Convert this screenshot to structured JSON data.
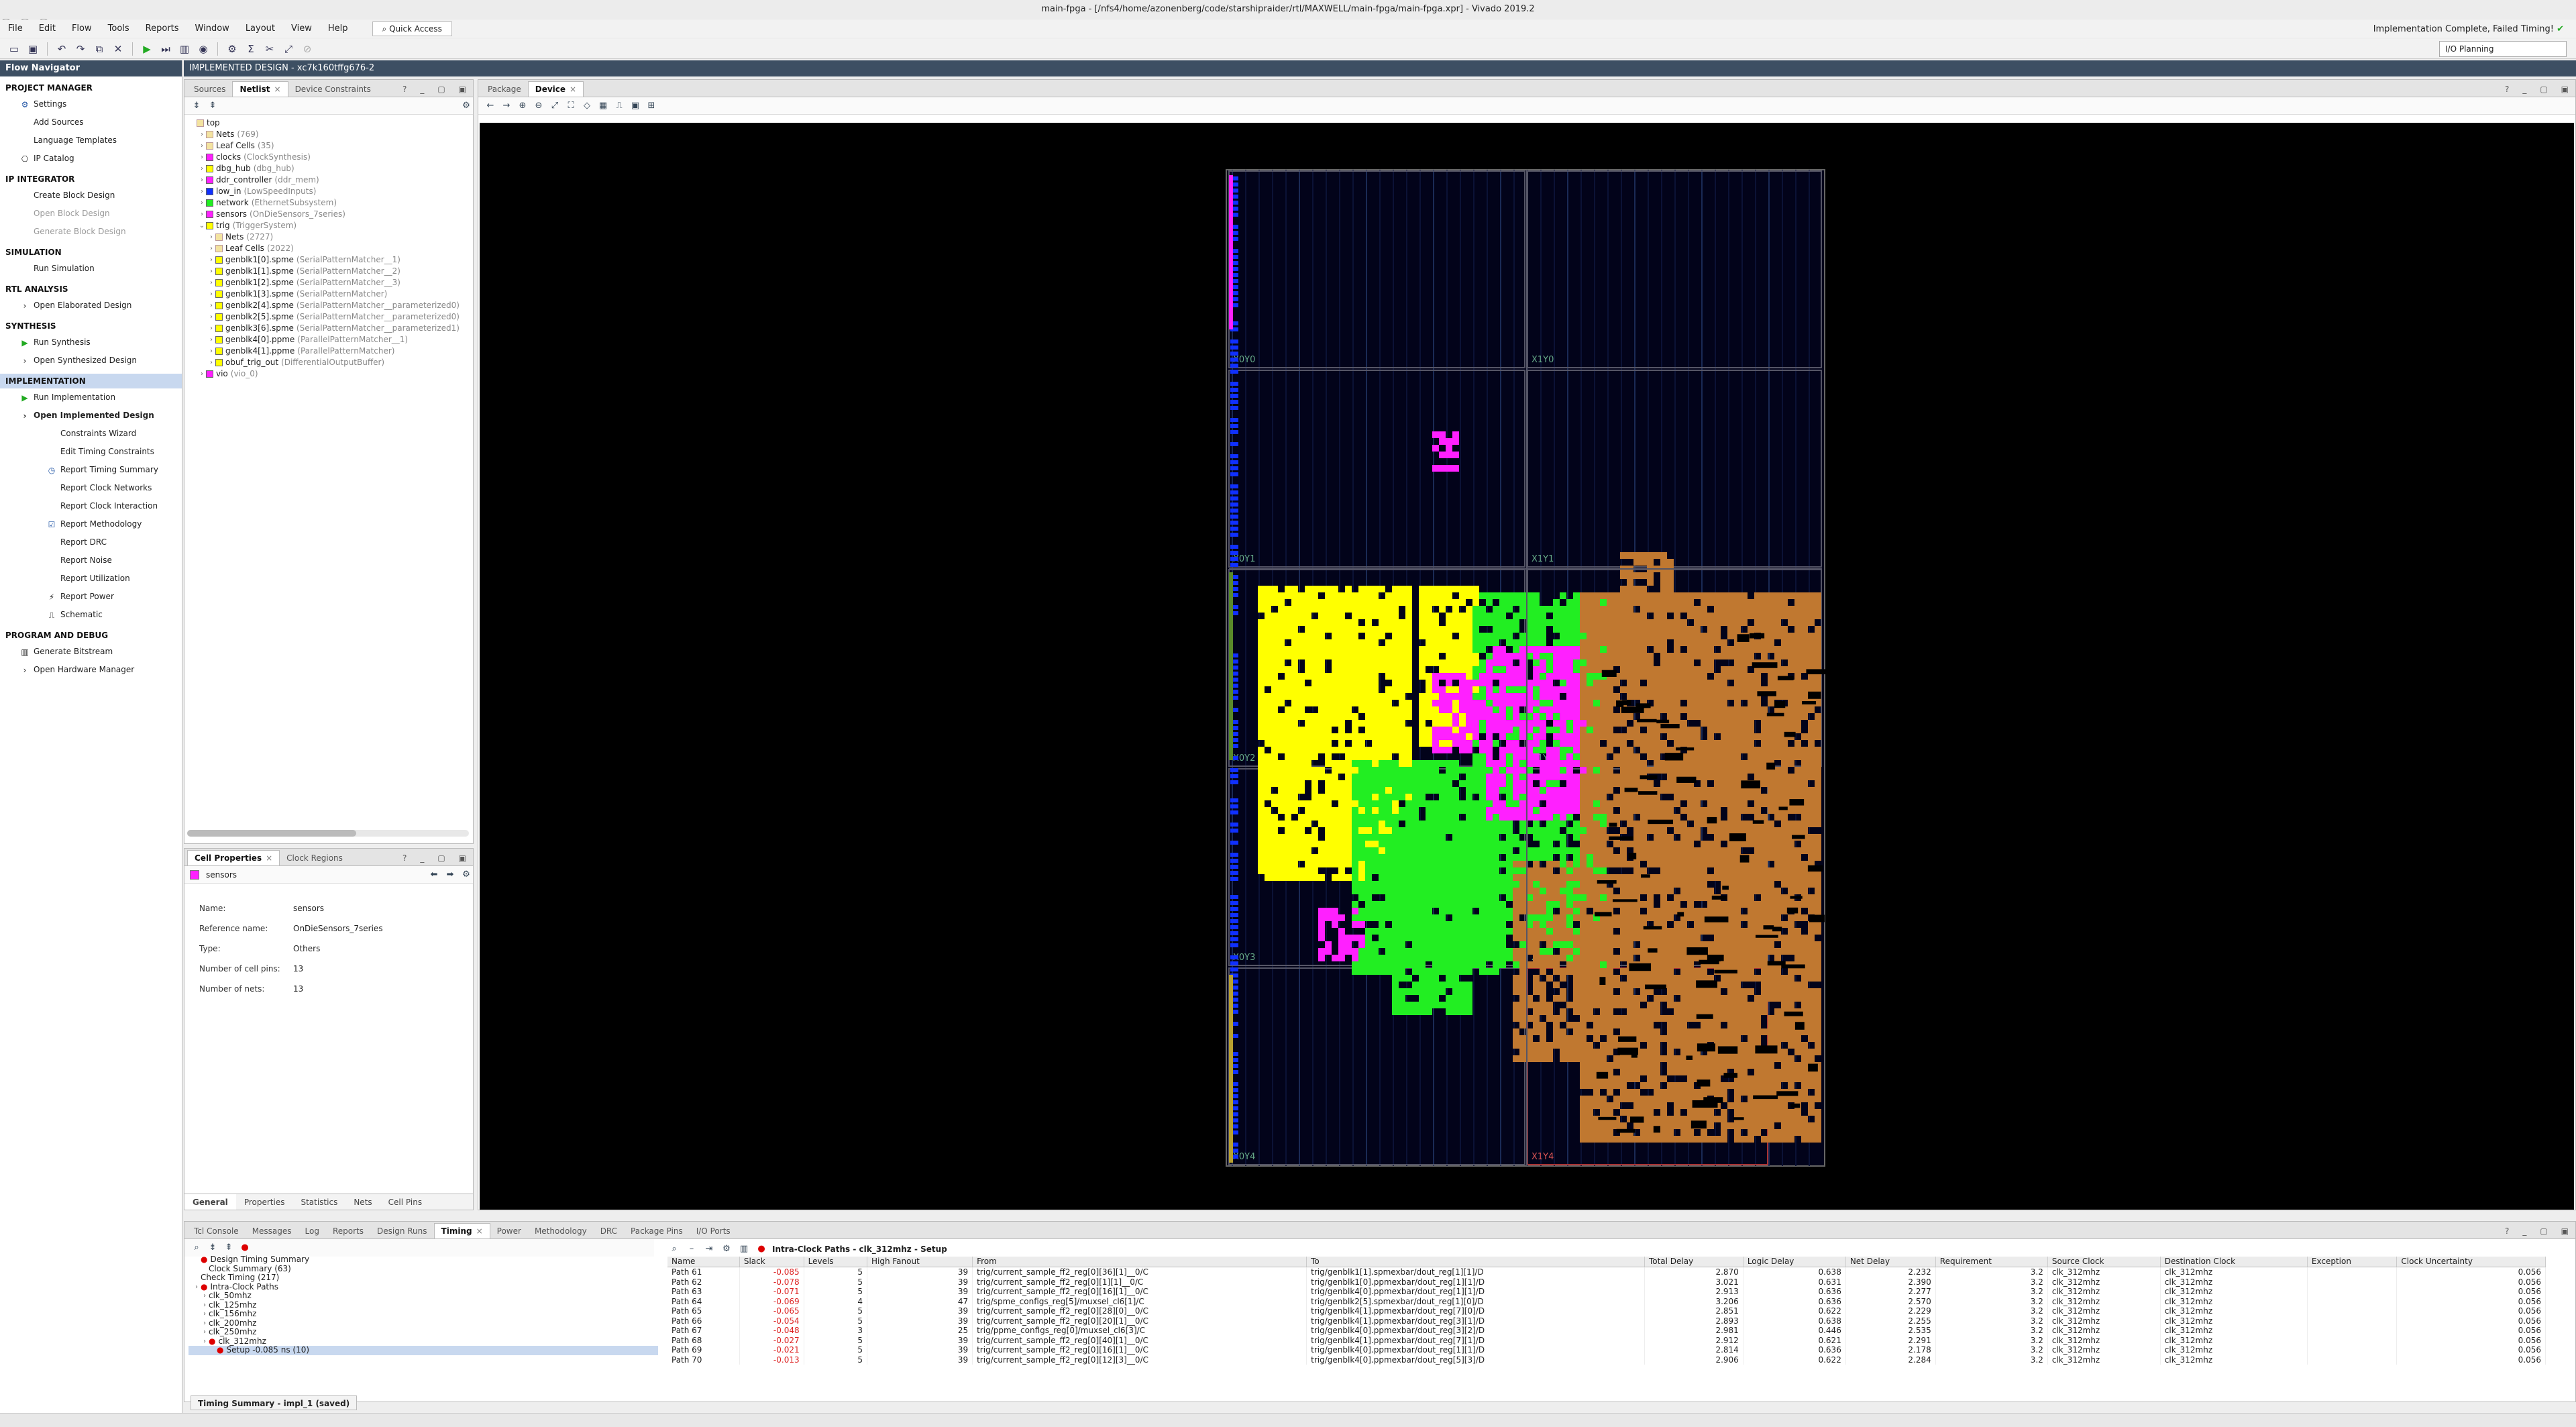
{
  "window": {
    "title": "main-fpga - [/nfs4/home/azonenberg/code/starshipraider/rtl/MAXWELL/main-fpga/main-fpga.xpr] - Vivado 2019.2",
    "status": "Implementation Complete, Failed Timing!"
  },
  "menu": [
    "File",
    "Edit",
    "Flow",
    "Tools",
    "Reports",
    "Window",
    "Layout",
    "View",
    "Help"
  ],
  "quick_access": "Quick Access",
  "layout_select": "I/O Planning",
  "flow_navigator": {
    "title": "Flow Navigator",
    "sections": [
      {
        "title": "PROJECT MANAGER",
        "items": [
          {
            "label": "Settings",
            "icon": "gear-icon"
          },
          {
            "label": "Add Sources"
          },
          {
            "label": "Language Templates"
          },
          {
            "label": "IP Catalog",
            "icon": "ip-icon"
          }
        ]
      },
      {
        "title": "IP INTEGRATOR",
        "items": [
          {
            "label": "Create Block Design"
          },
          {
            "label": "Open Block Design",
            "disabled": true
          },
          {
            "label": "Generate Block Design",
            "disabled": true
          }
        ]
      },
      {
        "title": "SIMULATION",
        "items": [
          {
            "label": "Run Simulation"
          }
        ]
      },
      {
        "title": "RTL ANALYSIS",
        "items": [
          {
            "label": "Open Elaborated Design",
            "expander": true
          }
        ]
      },
      {
        "title": "SYNTHESIS",
        "items": [
          {
            "label": "Run Synthesis",
            "icon": "run-icon"
          },
          {
            "label": "Open Synthesized Design",
            "expander": true
          }
        ]
      },
      {
        "title": "IMPLEMENTATION",
        "active": true,
        "items": [
          {
            "label": "Run Implementation",
            "icon": "run-icon"
          },
          {
            "label": "Open Implemented Design",
            "expander": true,
            "bold": true
          },
          {
            "label": "Constraints Wizard",
            "indent": 2
          },
          {
            "label": "Edit Timing Constraints",
            "indent": 2
          },
          {
            "label": "Report Timing Summary",
            "indent": 2,
            "icon": "clock-icon"
          },
          {
            "label": "Report Clock Networks",
            "indent": 2
          },
          {
            "label": "Report Clock Interaction",
            "indent": 2
          },
          {
            "label": "Report Methodology",
            "indent": 2,
            "icon": "check-icon"
          },
          {
            "label": "Report DRC",
            "indent": 2
          },
          {
            "label": "Report Noise",
            "indent": 2
          },
          {
            "label": "Report Utilization",
            "indent": 2
          },
          {
            "label": "Report Power",
            "indent": 2,
            "icon": "power-icon"
          },
          {
            "label": "Schematic",
            "indent": 2,
            "icon": "schematic-icon"
          }
        ]
      },
      {
        "title": "PROGRAM AND DEBUG",
        "items": [
          {
            "label": "Generate Bitstream",
            "icon": "bitstream-icon"
          },
          {
            "label": "Open Hardware Manager",
            "expander": true
          }
        ]
      }
    ]
  },
  "impl_header": "IMPLEMENTED DESIGN - xc7k160tffg676-2",
  "netlist": {
    "tabs": [
      "Sources",
      "Netlist",
      "Device Constraints"
    ],
    "selected": 1,
    "tree": [
      {
        "t": "top",
        "d": 0
      },
      {
        "t": "Nets",
        "s": "(769)",
        "d": 1
      },
      {
        "t": "Leaf Cells",
        "s": "(35)",
        "d": 1
      },
      {
        "t": "clocks",
        "s": "(ClockSynthesis)",
        "d": 1,
        "c": "#ff20ff"
      },
      {
        "t": "dbg_hub",
        "s": "(dbg_hub)",
        "d": 1,
        "c": "#ffff00"
      },
      {
        "t": "ddr_controller",
        "s": "(ddr_mem)",
        "d": 1,
        "c": "#ff20ff"
      },
      {
        "t": "low_in",
        "s": "(LowSpeedInputs)",
        "d": 1,
        "c": "#1030ff"
      },
      {
        "t": "network",
        "s": "(EthernetSubsystem)",
        "d": 1,
        "c": "#22ee22"
      },
      {
        "t": "sensors",
        "s": "(OnDieSensors_7series)",
        "d": 1,
        "c": "#ff20ff"
      },
      {
        "t": "trig",
        "s": "(TriggerSystem)",
        "d": 1,
        "c": "#ffff00",
        "open": true
      },
      {
        "t": "Nets",
        "s": "(2727)",
        "d": 2
      },
      {
        "t": "Leaf Cells",
        "s": "(2022)",
        "d": 2
      },
      {
        "t": "genblk1[0].spme",
        "s": "(SerialPatternMatcher__1)",
        "d": 2,
        "c": "#ffff00"
      },
      {
        "t": "genblk1[1].spme",
        "s": "(SerialPatternMatcher__2)",
        "d": 2,
        "c": "#ffff00"
      },
      {
        "t": "genblk1[2].spme",
        "s": "(SerialPatternMatcher__3)",
        "d": 2,
        "c": "#ffff00"
      },
      {
        "t": "genblk1[3].spme",
        "s": "(SerialPatternMatcher)",
        "d": 2,
        "c": "#ffff00"
      },
      {
        "t": "genblk2[4].spme",
        "s": "(SerialPatternMatcher__parameterized0)",
        "d": 2,
        "c": "#ffff00"
      },
      {
        "t": "genblk2[5].spme",
        "s": "(SerialPatternMatcher__parameterized0)",
        "d": 2,
        "c": "#ffff00"
      },
      {
        "t": "genblk3[6].spme",
        "s": "(SerialPatternMatcher__parameterized1)",
        "d": 2,
        "c": "#ffff00"
      },
      {
        "t": "genblk4[0].ppme",
        "s": "(ParallelPatternMatcher__1)",
        "d": 2,
        "c": "#ffff00"
      },
      {
        "t": "genblk4[1].ppme",
        "s": "(ParallelPatternMatcher)",
        "d": 2,
        "c": "#ffff00"
      },
      {
        "t": "obuf_trig_out",
        "s": "(DifferentialOutputBuffer)",
        "d": 2,
        "c": "#ffff00"
      },
      {
        "t": "vio",
        "s": "(vio_0)",
        "d": 1,
        "c": "#ff20ff"
      }
    ]
  },
  "cell_properties": {
    "tabs": [
      "Cell Properties",
      "Clock Regions"
    ],
    "cell": "sensors",
    "rows": [
      {
        "k": "Name:",
        "v": "sensors"
      },
      {
        "k": "Reference name:",
        "v": "OnDieSensors_7series"
      },
      {
        "k": "Type:",
        "v": "Others"
      },
      {
        "k": "Number of cell pins:",
        "v": "13"
      },
      {
        "k": "Number of nets:",
        "v": "13"
      }
    ],
    "bottom_tabs": [
      "General",
      "Properties",
      "Statistics",
      "Nets",
      "Cell Pins"
    ]
  },
  "device": {
    "tabs": [
      "Package",
      "Device"
    ],
    "selected": 1,
    "regions": [
      "X0Y4",
      "X1Y4",
      "X0Y3",
      "X1Y3",
      "X0Y2",
      "X1Y2",
      "X0Y1",
      "X1Y1",
      "X0Y0",
      "X1Y0"
    ]
  },
  "bottom": {
    "tabs": [
      "Tcl Console",
      "Messages",
      "Log",
      "Reports",
      "Design Runs",
      "Timing",
      "Power",
      "Methodology",
      "DRC",
      "Package Pins",
      "I/O Ports"
    ],
    "selected": 5,
    "tree": [
      "Design Timing Summary",
      "Clock Summary (63)",
      "Check Timing (217)",
      "Intra-Clock Paths",
      "clk_50mhz",
      "clk_125mhz",
      "clk_156mhz",
      "clk_200mhz",
      "clk_250mhz",
      "clk_312mhz",
      "Setup -0.085 ns (10)"
    ],
    "table_title": "Intra-Clock Paths - clk_312mhz - Setup",
    "columns": [
      "Name",
      "Slack",
      "Levels",
      "High Fanout",
      "From",
      "To",
      "Total Delay",
      "Logic Delay",
      "Net Delay",
      "Requirement",
      "Source Clock",
      "Destination Clock",
      "Exception",
      "Clock Uncertainty"
    ],
    "rows": [
      [
        "Path 61",
        "-0.085",
        "5",
        "39",
        "trig/current_sample_ff2_reg[0][36][1]__0/C",
        "trig/genblk1[1].spmexbar/dout_reg[1][1]/D",
        "2.870",
        "0.638",
        "2.232",
        "3.2",
        "clk_312mhz",
        "clk_312mhz",
        "",
        "0.056"
      ],
      [
        "Path 62",
        "-0.078",
        "5",
        "39",
        "trig/current_sample_ff2_reg[0][1][1]__0/C",
        "trig/genblk1[0].ppmexbar/dout_reg[1][1]/D",
        "3.021",
        "0.631",
        "2.390",
        "3.2",
        "clk_312mhz",
        "clk_312mhz",
        "",
        "0.056"
      ],
      [
        "Path 63",
        "-0.071",
        "5",
        "39",
        "trig/current_sample_ff2_reg[0][16][1]__0/C",
        "trig/genblk4[0].ppmexbar/dout_reg[1][1]/D",
        "2.913",
        "0.636",
        "2.277",
        "3.2",
        "clk_312mhz",
        "clk_312mhz",
        "",
        "0.056"
      ],
      [
        "Path 64",
        "-0.069",
        "4",
        "47",
        "trig/spme_configs_reg[5]/muxsel_cl6[1]/C",
        "trig/genblk2[5].spmexbar/dout_reg[1][0]/D",
        "3.206",
        "0.636",
        "2.570",
        "3.2",
        "clk_312mhz",
        "clk_312mhz",
        "",
        "0.056"
      ],
      [
        "Path 65",
        "-0.065",
        "5",
        "39",
        "trig/current_sample_ff2_reg[0][28][0]__0/C",
        "trig/genblk4[1].ppmexbar/dout_reg[7][0]/D",
        "2.851",
        "0.622",
        "2.229",
        "3.2",
        "clk_312mhz",
        "clk_312mhz",
        "",
        "0.056"
      ],
      [
        "Path 66",
        "-0.054",
        "5",
        "39",
        "trig/current_sample_ff2_reg[0][20][1]__0/C",
        "trig/genblk4[1].ppmexbar/dout_reg[3][1]/D",
        "2.893",
        "0.638",
        "2.255",
        "3.2",
        "clk_312mhz",
        "clk_312mhz",
        "",
        "0.056"
      ],
      [
        "Path 67",
        "-0.048",
        "3",
        "25",
        "trig/ppme_configs_reg[0]/muxsel_cl6[3]/C",
        "trig/genblk4[0].ppmexbar/dout_reg[3][2]/D",
        "2.981",
        "0.446",
        "2.535",
        "3.2",
        "clk_312mhz",
        "clk_312mhz",
        "",
        "0.056"
      ],
      [
        "Path 68",
        "-0.027",
        "5",
        "39",
        "trig/current_sample_ff2_reg[0][40][1]__0/C",
        "trig/genblk4[1].ppmexbar/dout_reg[7][1]/D",
        "2.912",
        "0.621",
        "2.291",
        "3.2",
        "clk_312mhz",
        "clk_312mhz",
        "",
        "0.056"
      ],
      [
        "Path 69",
        "-0.021",
        "5",
        "39",
        "trig/current_sample_ff2_reg[0][16][1]__0/C",
        "trig/genblk4[0].ppmexbar/dout_reg[1][1]/D",
        "2.814",
        "0.636",
        "2.178",
        "3.2",
        "clk_312mhz",
        "clk_312mhz",
        "",
        "0.056"
      ],
      [
        "Path 70",
        "-0.013",
        "5",
        "39",
        "trig/current_sample_ff2_reg[0][12][3]__0/C",
        "trig/genblk4[0].ppmexbar/dout_reg[5][3]/D",
        "2.906",
        "0.622",
        "2.284",
        "3.2",
        "clk_312mhz",
        "clk_312mhz",
        "",
        "0.056"
      ]
    ]
  },
  "timing_summary_tab": "Timing Summary - impl_1 (saved)",
  "colors": {
    "panel_header": "#3d4f63",
    "yellow": "#ffff00",
    "magenta": "#ff20ff",
    "green": "#22ee22",
    "brown": "#c07830",
    "blue": "#1030ff"
  }
}
